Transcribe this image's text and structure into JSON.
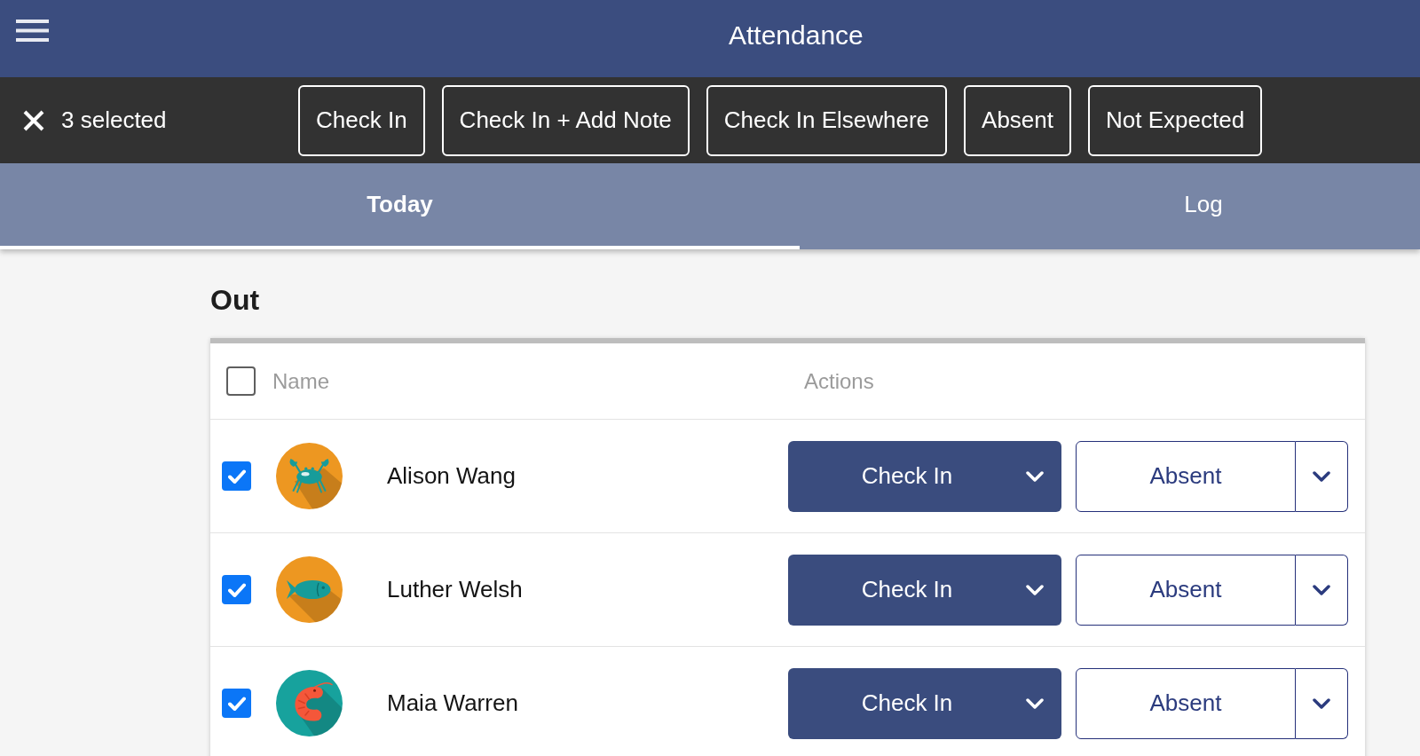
{
  "app_bar": {
    "title": "Attendance"
  },
  "selection_bar": {
    "count_label": "3 selected",
    "actions": [
      "Check In",
      "Check In + Add Note",
      "Check In Elsewhere",
      "Absent",
      "Not Expected"
    ]
  },
  "tabs": [
    {
      "label": "Today",
      "selected": true
    },
    {
      "label": "Log",
      "selected": false
    }
  ],
  "section": {
    "title": "Out",
    "table": {
      "select_all": {
        "checked": false
      },
      "columns": [
        "Name",
        "Actions"
      ],
      "rows": [
        {
          "name": "Alison Wang",
          "checked": true,
          "color": "#ed9721",
          "primary_action": "Check In",
          "secondary_action": "Absent"
        },
        {
          "name": "Luther Welsh",
          "checked": true,
          "color": "#ed9721",
          "primary_action": "Check In",
          "secondary_action": "Absent"
        },
        {
          "name": "Maia Warren",
          "checked": true,
          "color": "#17a29d",
          "primary_action": "Check In",
          "secondary_action": "Absent"
        }
      ]
    }
  }
}
